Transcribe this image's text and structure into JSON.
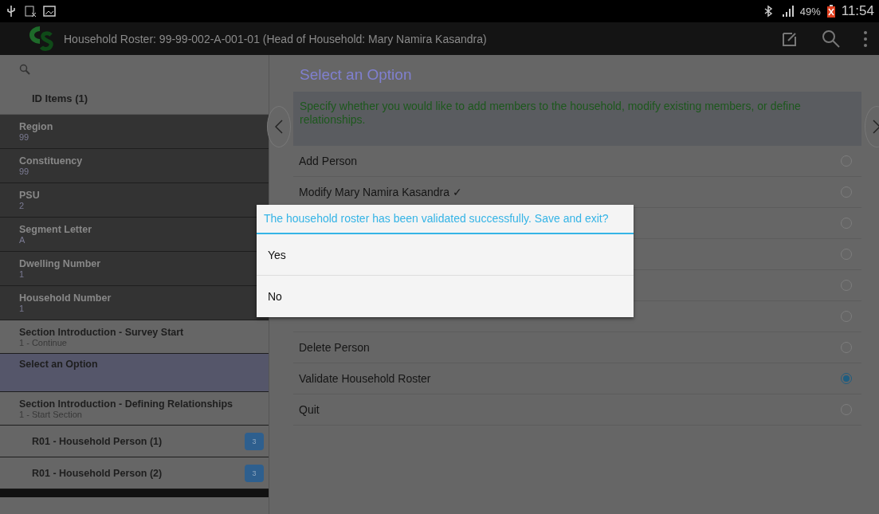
{
  "status_bar": {
    "time": "11:54",
    "battery": "49%"
  },
  "action_bar": {
    "title": "Household Roster: 99-99-002-A-001-01 (Head of Household: Mary Namira Kasandra)"
  },
  "sidebar": {
    "group": {
      "label": "ID Items (1)"
    },
    "items": [
      {
        "kind": "id",
        "label": "Region",
        "value": "99",
        "selected": false
      },
      {
        "kind": "id",
        "label": "Constituency",
        "value": "99",
        "selected": false
      },
      {
        "kind": "id",
        "label": "PSU",
        "value": "2",
        "selected": false
      },
      {
        "kind": "id",
        "label": "Segment Letter",
        "value": "A",
        "selected": false
      },
      {
        "kind": "id",
        "label": "Dwelling Number",
        "value": "1",
        "selected": false
      },
      {
        "kind": "id",
        "label": "Household Number",
        "value": "1",
        "selected": false
      },
      {
        "kind": "field",
        "label": "Section Introduction - Survey Start",
        "value": "1 - Continue",
        "selected": false
      },
      {
        "kind": "field",
        "label": "Select an Option",
        "selected": true
      },
      {
        "kind": "field",
        "label": "Section Introduction - Defining Relationships",
        "value": "1 - Start Section",
        "selected": false
      },
      {
        "kind": "roster",
        "label": "R01 - Household Person (1)",
        "badge": "3",
        "selected": false
      },
      {
        "kind": "roster",
        "label": "R01 - Household Person (2)",
        "badge": "3",
        "selected": false
      }
    ]
  },
  "question": {
    "title": "Select an Option",
    "instruction": "Specify whether you would like to add members to the household, modify existing members, or define relationships.",
    "options": [
      {
        "label": "Add Person",
        "selected": false
      },
      {
        "label": "Modify Mary Namira Kasandra ✓",
        "selected": false
      },
      {
        "selected": false
      },
      {
        "selected": false
      },
      {
        "selected": false
      },
      {
        "selected": false
      },
      {
        "label": "Delete Person",
        "selected": false
      },
      {
        "label": "Validate Household Roster",
        "selected": true
      },
      {
        "label": "Quit",
        "selected": false
      }
    ]
  },
  "dialog": {
    "message": "The household roster has been validated successfully. Save and exit?",
    "buttons": [
      "Yes",
      "No"
    ]
  }
}
